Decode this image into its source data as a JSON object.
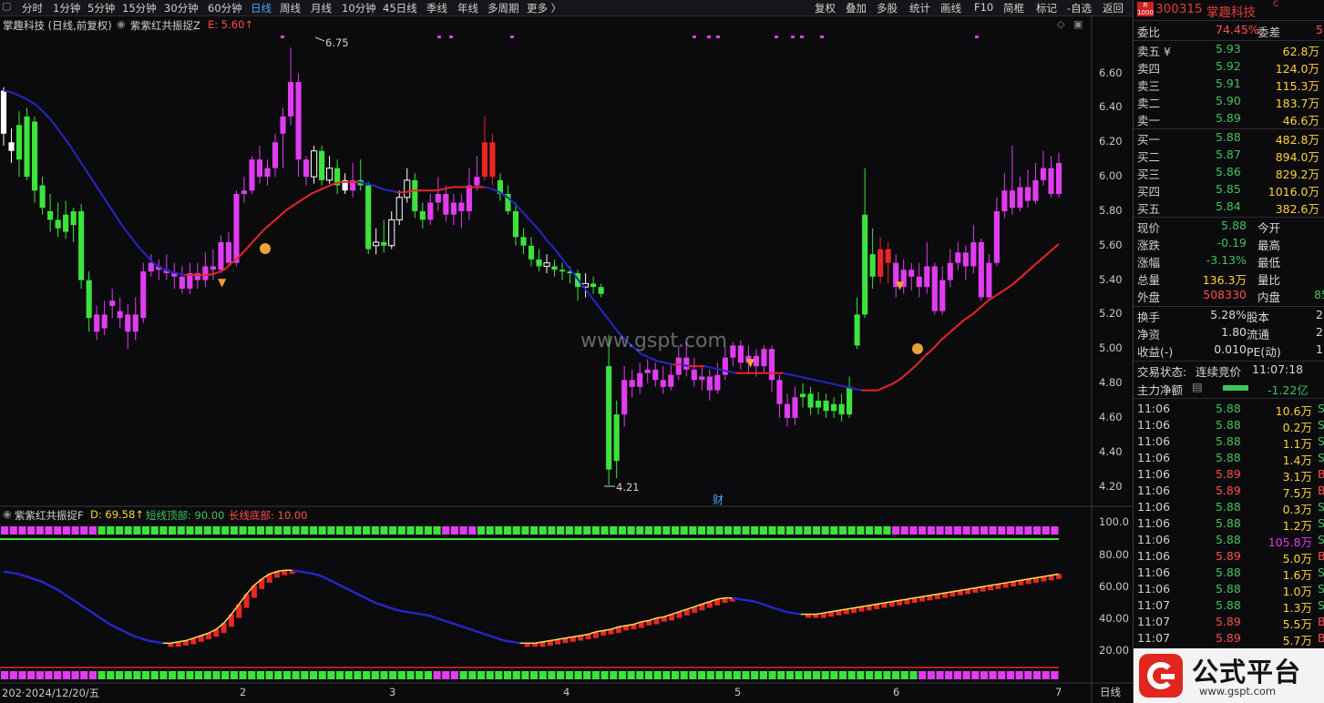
{
  "toolbar": {
    "left": [
      "分时",
      "1分钟",
      "5分钟",
      "15分钟",
      "30分钟",
      "60分钟",
      "日线",
      "周线",
      "月线",
      "10分钟",
      "45日线",
      "季线",
      "年线",
      "多周期",
      "更多 〉"
    ],
    "active": "日线",
    "right": [
      "复权",
      "叠加",
      "多股",
      "统计",
      "画线",
      "F10",
      "简框",
      "标记",
      "-自选",
      "返回"
    ]
  },
  "main_chart": {
    "title": "掌趣科技 (日线,前复权)",
    "indicator_name": "紫紫红共振捉Z",
    "indicator_value": "E: 5.60↑",
    "high_label": "6.75",
    "low_label": "4.21",
    "marker_label": "财",
    "watermark": "www.gspt.com",
    "y_ticks": [
      "6.60",
      "6.40",
      "6.20",
      "6.00",
      "5.80",
      "5.60",
      "5.40",
      "5.20",
      "5.00",
      "4.80",
      "4.60",
      "4.40",
      "4.20"
    ],
    "ylim": [
      4.15,
      6.82
    ]
  },
  "sub_chart": {
    "indicator_name": "紫紫红共振捉F",
    "d_value": "D: 69.58↑",
    "short_top": "短线顶部: 90.00",
    "long_bottom": "长线底部: 10.00",
    "y_ticks": [
      "100.0",
      "80.00",
      "60.00",
      "40.00",
      "20.00"
    ]
  },
  "x_axis": {
    "labels": [
      "202·2024/12/20/五",
      "2",
      "3",
      "4",
      "5",
      "6",
      "7"
    ],
    "period_button": "日线"
  },
  "chart_data": {
    "type": "candlestick",
    "candles": [
      [
        6.5,
        6.25,
        6.52,
        6.18
      ],
      [
        6.2,
        6.15,
        6.28,
        6.08
      ],
      [
        6.3,
        6.1,
        6.38,
        6.0
      ],
      [
        6.35,
        6.0,
        6.4,
        5.98
      ],
      [
        6.32,
        5.92,
        6.35,
        5.85
      ],
      [
        5.95,
        5.82,
        6.0,
        5.78
      ],
      [
        5.8,
        5.75,
        5.9,
        5.68
      ],
      [
        5.75,
        5.7,
        5.85,
        5.65
      ],
      [
        5.78,
        5.68,
        5.86,
        5.64
      ],
      [
        5.8,
        5.72,
        5.82,
        5.62
      ],
      [
        5.8,
        5.4,
        5.84,
        5.35
      ],
      [
        5.4,
        5.18,
        5.45,
        5.1
      ],
      [
        5.2,
        5.1,
        5.25,
        5.05
      ],
      [
        5.12,
        5.2,
        5.28,
        5.08
      ],
      [
        5.25,
        5.28,
        5.35,
        5.18
      ],
      [
        5.22,
        5.18,
        5.3,
        5.12
      ],
      [
        5.2,
        5.1,
        5.26,
        5.0
      ],
      [
        5.1,
        5.2,
        5.3,
        5.05
      ],
      [
        5.18,
        5.45,
        5.5,
        5.15
      ],
      [
        5.45,
        5.5,
        5.55,
        5.42
      ],
      [
        5.48,
        5.46,
        5.52,
        5.4
      ],
      [
        5.46,
        5.44,
        5.55,
        5.4
      ],
      [
        5.44,
        5.42,
        5.5,
        5.35
      ],
      [
        5.42,
        5.35,
        5.48,
        5.32
      ],
      [
        5.35,
        5.44,
        5.5,
        5.32
      ],
      [
        5.44,
        5.4,
        5.5,
        5.35
      ],
      [
        5.4,
        5.48,
        5.56,
        5.36
      ],
      [
        5.48,
        5.46,
        5.58,
        5.4
      ],
      [
        5.46,
        5.62,
        5.66,
        5.44
      ],
      [
        5.62,
        5.5,
        5.68,
        5.48
      ],
      [
        5.5,
        5.9,
        5.92,
        5.48
      ],
      [
        5.9,
        5.92,
        6.0,
        5.85
      ],
      [
        5.92,
        6.1,
        6.12,
        5.9
      ],
      [
        6.1,
        6.0,
        6.18,
        5.96
      ],
      [
        6.0,
        6.05,
        6.1,
        5.95
      ],
      [
        6.05,
        6.2,
        6.25,
        6.0
      ],
      [
        6.25,
        6.35,
        6.4,
        6.05
      ],
      [
        6.35,
        6.55,
        6.75,
        6.3
      ],
      [
        6.55,
        6.1,
        6.6,
        6.0
      ],
      [
        6.1,
        6.0,
        6.12,
        5.95
      ],
      [
        6.0,
        6.15,
        6.18,
        5.96
      ],
      [
        6.15,
        5.98,
        6.18,
        5.95
      ],
      [
        5.98,
        6.05,
        6.12,
        5.96
      ],
      [
        6.05,
        5.95,
        6.1,
        5.9
      ],
      [
        5.98,
        5.92,
        6.02,
        5.9
      ],
      [
        5.92,
        5.98,
        6.08,
        5.88
      ],
      [
        5.98,
        5.95,
        6.1,
        5.92
      ],
      [
        5.95,
        5.58,
        5.97,
        5.55
      ],
      [
        5.6,
        5.62,
        5.7,
        5.55
      ],
      [
        5.62,
        5.6,
        5.75,
        5.56
      ],
      [
        5.6,
        5.75,
        5.8,
        5.58
      ],
      [
        5.75,
        5.88,
        5.92,
        5.72
      ],
      [
        5.88,
        5.98,
        6.05,
        5.85
      ],
      [
        5.98,
        5.8,
        6.02,
        5.76
      ],
      [
        5.8,
        5.75,
        5.85,
        5.7
      ],
      [
        5.75,
        5.85,
        5.9,
        5.72
      ],
      [
        5.85,
        5.9,
        6.0,
        5.8
      ],
      [
        5.9,
        5.78,
        5.95,
        5.74
      ],
      [
        5.78,
        5.85,
        5.9,
        5.72
      ],
      [
        5.85,
        5.8,
        5.9,
        5.7
      ],
      [
        5.8,
        5.95,
        6.05,
        5.75
      ],
      [
        5.95,
        6.0,
        6.12,
        5.92
      ],
      [
        6.0,
        6.2,
        6.35,
        5.98
      ],
      [
        6.2,
        6.0,
        6.25,
        5.95
      ],
      [
        5.98,
        5.9,
        6.02,
        5.86
      ],
      [
        5.9,
        5.8,
        5.95,
        5.78
      ],
      [
        5.8,
        5.65,
        5.85,
        5.6
      ],
      [
        5.65,
        5.6,
        5.7,
        5.55
      ],
      [
        5.6,
        5.52,
        5.65,
        5.48
      ],
      [
        5.52,
        5.48,
        5.58,
        5.45
      ],
      [
        5.48,
        5.5,
        5.55,
        5.44
      ],
      [
        5.48,
        5.46,
        5.52,
        5.42
      ],
      [
        5.46,
        5.45,
        5.5,
        5.4
      ],
      [
        5.45,
        5.44,
        5.48,
        5.38
      ],
      [
        5.44,
        5.36,
        5.46,
        5.28
      ],
      [
        5.36,
        5.38,
        5.44,
        5.3
      ],
      [
        5.38,
        5.36,
        5.42,
        5.32
      ],
      [
        5.36,
        5.32,
        5.38,
        5.3
      ],
      [
        4.9,
        4.3,
        5.08,
        4.21
      ],
      [
        4.35,
        4.62,
        4.7,
        4.25
      ],
      [
        4.62,
        4.82,
        4.9,
        4.55
      ],
      [
        4.82,
        4.78,
        4.88,
        4.72
      ],
      [
        4.78,
        4.86,
        4.92,
        4.74
      ],
      [
        4.86,
        4.88,
        4.94,
        4.8
      ],
      [
        4.88,
        4.82,
        4.92,
        4.78
      ],
      [
        4.82,
        4.78,
        4.9,
        4.74
      ],
      [
        4.78,
        4.85,
        4.92,
        4.76
      ],
      [
        4.85,
        4.95,
        5.02,
        4.82
      ],
      [
        4.95,
        4.88,
        5.04,
        4.84
      ],
      [
        4.88,
        4.82,
        4.95,
        4.78
      ],
      [
        4.82,
        4.84,
        4.9,
        4.76
      ],
      [
        4.84,
        4.76,
        4.88,
        4.7
      ],
      [
        4.76,
        4.85,
        4.92,
        4.74
      ],
      [
        4.85,
        4.95,
        5.02,
        4.82
      ],
      [
        4.95,
        5.02,
        5.04,
        4.9
      ],
      [
        5.02,
        4.92,
        5.05,
        4.88
      ],
      [
        4.92,
        4.96,
        5.02,
        4.86
      ],
      [
        4.96,
        4.9,
        5.0,
        4.84
      ],
      [
        4.9,
        5.0,
        5.02,
        4.86
      ],
      [
        5.0,
        4.82,
        5.02,
        4.75
      ],
      [
        4.82,
        4.68,
        4.85,
        4.6
      ],
      [
        4.68,
        4.6,
        4.74,
        4.55
      ],
      [
        4.6,
        4.72,
        4.78,
        4.56
      ],
      [
        4.72,
        4.74,
        4.8,
        4.66
      ],
      [
        4.74,
        4.66,
        4.78,
        4.62
      ],
      [
        4.66,
        4.7,
        4.75,
        4.62
      ],
      [
        4.7,
        4.64,
        4.74,
        4.6
      ],
      [
        4.64,
        4.68,
        4.72,
        4.6
      ],
      [
        4.68,
        4.62,
        4.74,
        4.58
      ],
      [
        4.62,
        4.78,
        4.84,
        4.6
      ],
      [
        5.02,
        5.2,
        5.3,
        5.0
      ],
      [
        5.2,
        5.78,
        6.05,
        5.18
      ],
      [
        5.55,
        5.42,
        5.7,
        5.35
      ],
      [
        5.42,
        5.58,
        5.65,
        5.38
      ],
      [
        5.58,
        5.5,
        5.62,
        5.38
      ],
      [
        5.5,
        5.36,
        5.55,
        5.3
      ],
      [
        5.36,
        5.46,
        5.52,
        5.32
      ],
      [
        5.46,
        5.42,
        5.5,
        5.34
      ],
      [
        5.42,
        5.36,
        5.5,
        5.3
      ],
      [
        5.36,
        5.48,
        5.62,
        5.32
      ],
      [
        5.48,
        5.22,
        5.5,
        5.2
      ],
      [
        5.22,
        5.4,
        5.48,
        5.2
      ],
      [
        5.4,
        5.5,
        5.58,
        5.36
      ],
      [
        5.5,
        5.56,
        5.62,
        5.46
      ],
      [
        5.56,
        5.48,
        5.6,
        5.4
      ],
      [
        5.48,
        5.62,
        5.72,
        5.44
      ],
      [
        5.62,
        5.3,
        5.64,
        5.28
      ],
      [
        5.3,
        5.5,
        5.55,
        5.28
      ],
      [
        5.5,
        5.8,
        5.88,
        5.48
      ],
      [
        5.8,
        5.92,
        6.02,
        5.76
      ],
      [
        5.92,
        5.82,
        6.18,
        5.78
      ],
      [
        5.82,
        5.94,
        6.0,
        5.8
      ],
      [
        5.94,
        5.86,
        6.04,
        5.82
      ],
      [
        5.86,
        5.98,
        6.08,
        5.84
      ],
      [
        5.98,
        6.05,
        6.15,
        5.95
      ],
      [
        6.05,
        5.9,
        6.12,
        5.88
      ],
      [
        5.9,
        6.08,
        6.14,
        5.88
      ]
    ],
    "ma": [
      6.5,
      6.49,
      6.47,
      6.45,
      6.42,
      6.38,
      6.33,
      6.27,
      6.21,
      6.14,
      6.07,
      6.0,
      5.93,
      5.86,
      5.79,
      5.72,
      5.66,
      5.6,
      5.55,
      5.5,
      5.47,
      5.45,
      5.44,
      5.43,
      5.43,
      5.43,
      5.43,
      5.44,
      5.46,
      5.5,
      5.54,
      5.59,
      5.64,
      5.69,
      5.73,
      5.77,
      5.81,
      5.84,
      5.87,
      5.9,
      5.92,
      5.94,
      5.96,
      5.97,
      5.97,
      5.97,
      5.96,
      5.95,
      5.93,
      5.92,
      5.91,
      5.91,
      5.92,
      5.92,
      5.92,
      5.92,
      5.93,
      5.94,
      5.94,
      5.94,
      5.94,
      5.94,
      5.93,
      5.91,
      5.88,
      5.84,
      5.79,
      5.74,
      5.69,
      5.63,
      5.58,
      5.52,
      5.46,
      5.4,
      5.34,
      5.28,
      5.22,
      5.16,
      5.1,
      5.05,
      5.01,
      4.97,
      4.95,
      4.93,
      4.92,
      4.91,
      4.91,
      4.9,
      4.9,
      4.9,
      4.89,
      4.88,
      4.87,
      4.86,
      4.86,
      4.86,
      4.86,
      4.86,
      4.86,
      4.86,
      4.85,
      4.84,
      4.83,
      4.82,
      4.81,
      4.8,
      4.79,
      4.78,
      4.77,
      4.76,
      4.76,
      4.76,
      4.78,
      4.8,
      4.83,
      4.87,
      4.91,
      4.96,
      5.0,
      5.05,
      5.09,
      5.13,
      5.17,
      5.2,
      5.24,
      5.28,
      5.31,
      5.34,
      5.37,
      5.41,
      5.45,
      5.49,
      5.53,
      5.57,
      5.61
    ],
    "oscillator": [
      72,
      71,
      70,
      68,
      66,
      64,
      61,
      58,
      54,
      50,
      46,
      42,
      38,
      34,
      30,
      27,
      24,
      21,
      19,
      17,
      16,
      15,
      15,
      16,
      17,
      19,
      21,
      23,
      26,
      31,
      38,
      46,
      54,
      61,
      66,
      70,
      72,
      73,
      73,
      72,
      71,
      70,
      68,
      65,
      62,
      59,
      56,
      53,
      50,
      47,
      45,
      43,
      41,
      40,
      39,
      38,
      37,
      35,
      33,
      31,
      29,
      27,
      25,
      23,
      21,
      19,
      17,
      16,
      15,
      15,
      15,
      16,
      17,
      18,
      19,
      20,
      21,
      22,
      24,
      25,
      26,
      28,
      29,
      30,
      32,
      33,
      35,
      36,
      38,
      40,
      42,
      44,
      46,
      48,
      50,
      51,
      51,
      50,
      49,
      48,
      46,
      44,
      42,
      40,
      39,
      38,
      38,
      38,
      39,
      40,
      41,
      42,
      43,
      44,
      45,
      46,
      47,
      48,
      49,
      50,
      51,
      52,
      53,
      54,
      55,
      56,
      57,
      58,
      59,
      60,
      61,
      62,
      63,
      64,
      65,
      66,
      67,
      68,
      69,
      70
    ]
  },
  "quote": {
    "header_code": "300315",
    "header_name": "掌趣科技",
    "header_badge": "R\n1000",
    "webi_label": "委比",
    "webi_value": "74.45%",
    "weicha_label": "委差",
    "weicha_value": "5",
    "sells": [
      {
        "label": "卖五 ¥",
        "price": "5.93",
        "vol": "62.8万"
      },
      {
        "label": "卖四",
        "price": "5.92",
        "vol": "124.0万"
      },
      {
        "label": "卖三",
        "price": "5.91",
        "vol": "115.3万"
      },
      {
        "label": "卖二",
        "price": "5.90",
        "vol": "183.7万"
      },
      {
        "label": "卖一",
        "price": "5.89",
        "vol": "46.6万"
      }
    ],
    "buys": [
      {
        "label": "买一",
        "price": "5.88",
        "vol": "482.8万"
      },
      {
        "label": "买二",
        "price": "5.87",
        "vol": "894.0万"
      },
      {
        "label": "买三",
        "price": "5.86",
        "vol": "829.2万"
      },
      {
        "label": "买四",
        "price": "5.85",
        "vol": "1016.0万"
      },
      {
        "label": "买五",
        "price": "5.84",
        "vol": "382.6万"
      }
    ],
    "stats": [
      {
        "k1": "现价",
        "v1": "5.88",
        "c1": "green",
        "k2": "今开",
        "v2": ""
      },
      {
        "k1": "涨跌",
        "v1": "-0.19",
        "c1": "green",
        "k2": "最高",
        "v2": ""
      },
      {
        "k1": "涨幅",
        "v1": "-3.13%",
        "c1": "green",
        "k2": "最低",
        "v2": ""
      },
      {
        "k1": "总量",
        "v1": "136.3万",
        "c1": "yellow",
        "k2": "量比",
        "v2": ""
      },
      {
        "k1": "外盘",
        "v1": "508330",
        "c1": "red",
        "k2": "内盘",
        "v2": "85"
      }
    ],
    "stats2": [
      {
        "k1": "换手",
        "v1": "5.28%",
        "k2": "股本",
        "v2": "2"
      },
      {
        "k1": "净资",
        "v1": "1.80",
        "k2": "流通",
        "v2": "2"
      },
      {
        "k1": "收益(-)",
        "v1": "0.010",
        "k2": "PE(动)",
        "v2": "1"
      }
    ],
    "trade_status_label": "交易状态:",
    "trade_status_value": "连续竞价",
    "trade_time": "11:07:18",
    "main_flow_label": "主力净额",
    "main_flow_value": "-1.22亿",
    "ticks": [
      {
        "t": "11:06",
        "p": "5.88",
        "v": "10.6万",
        "s": "S"
      },
      {
        "t": "11:06",
        "p": "5.88",
        "v": "0.2万",
        "s": "S"
      },
      {
        "t": "11:06",
        "p": "5.88",
        "v": "1.1万",
        "s": "S"
      },
      {
        "t": "11:06",
        "p": "5.88",
        "v": "1.4万",
        "s": "S"
      },
      {
        "t": "11:06",
        "p": "5.89",
        "v": "3.1万",
        "s": "B"
      },
      {
        "t": "11:06",
        "p": "5.89",
        "v": "7.5万",
        "s": "B"
      },
      {
        "t": "11:06",
        "p": "5.88",
        "v": "0.3万",
        "s": "S"
      },
      {
        "t": "11:06",
        "p": "5.88",
        "v": "1.2万",
        "s": "S"
      },
      {
        "t": "11:06",
        "p": "5.88",
        "v": "105.8万",
        "s": "S"
      },
      {
        "t": "11:06",
        "p": "5.89",
        "v": "5.0万",
        "s": "B"
      },
      {
        "t": "11:06",
        "p": "5.88",
        "v": "1.6万",
        "s": "S"
      },
      {
        "t": "11:06",
        "p": "5.88",
        "v": "1.0万",
        "s": "S"
      },
      {
        "t": "11:07",
        "p": "5.88",
        "v": "1.3万",
        "s": "S"
      },
      {
        "t": "11:07",
        "p": "5.89",
        "v": "5.5万",
        "s": "B"
      },
      {
        "t": "11:07",
        "p": "5.89",
        "v": "5.7万",
        "s": "B"
      }
    ]
  },
  "logo": {
    "brand": "公式平台",
    "url": "www.gspt.com"
  }
}
